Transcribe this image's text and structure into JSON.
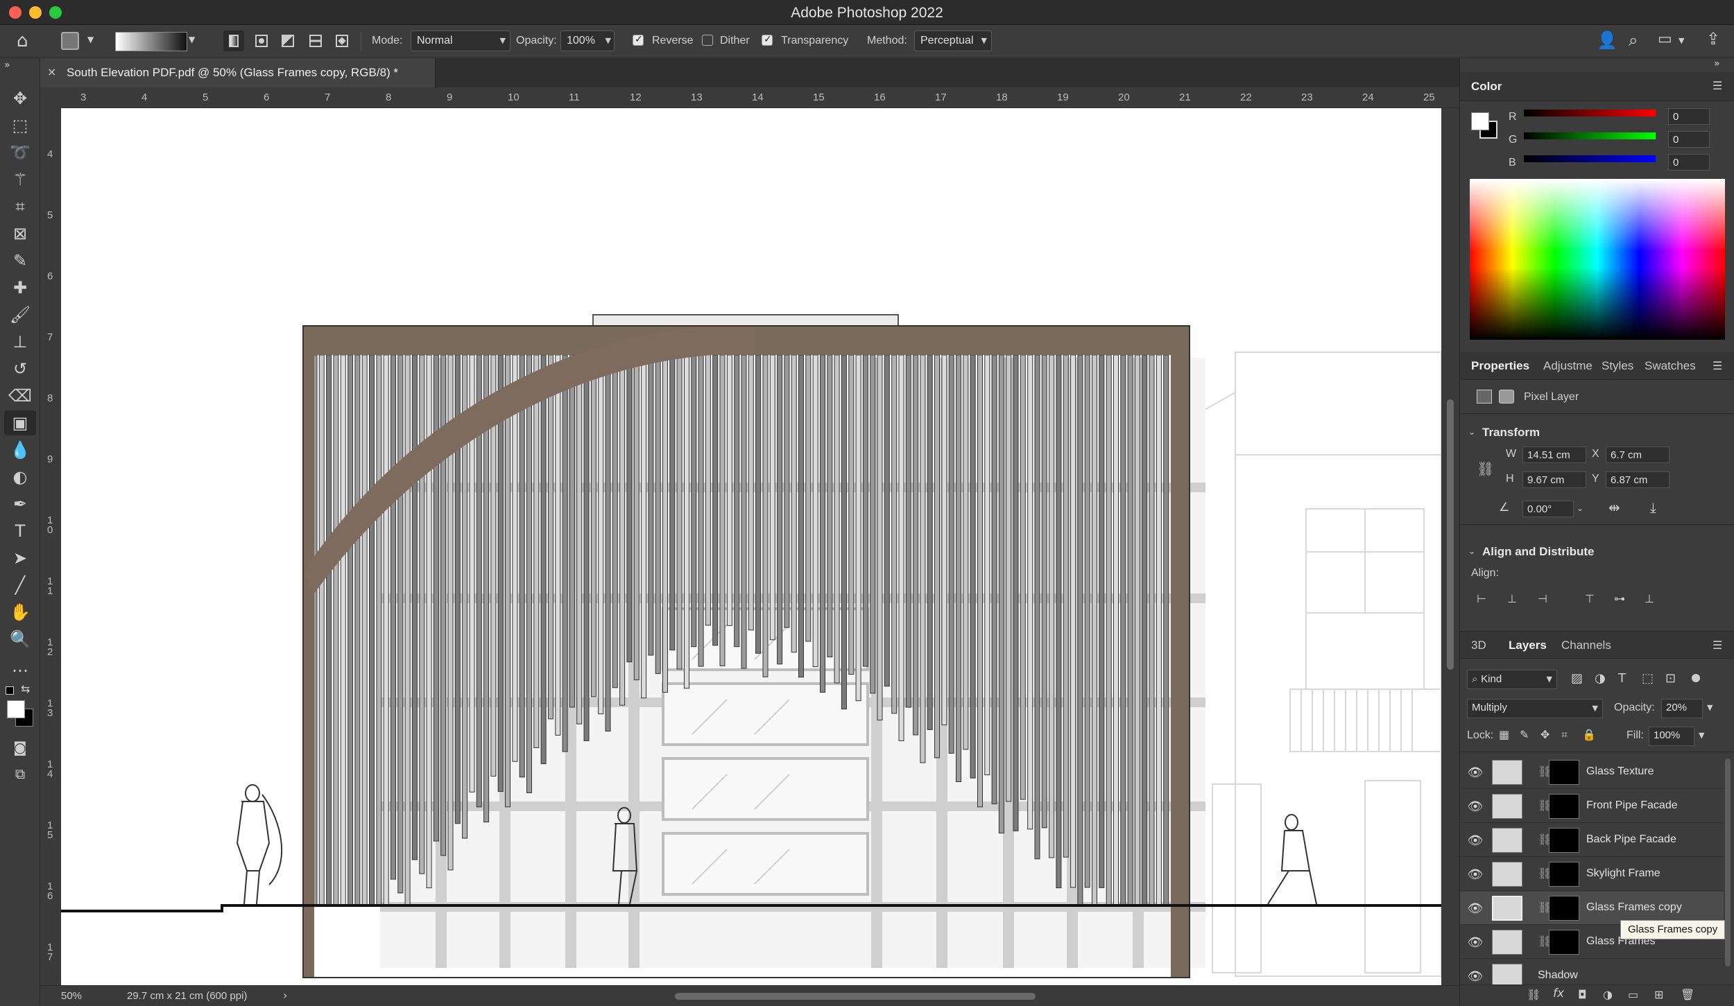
{
  "app": {
    "title": "Adobe Photoshop 2022"
  },
  "options": {
    "mode_label": "Mode:",
    "mode_value": "Normal",
    "opacity_label": "Opacity:",
    "opacity_value": "100%",
    "reverse_label": "Reverse",
    "reverse_checked": true,
    "dither_label": "Dither",
    "dither_checked": false,
    "transparency_label": "Transparency",
    "transparency_checked": true,
    "method_label": "Method:",
    "method_value": "Perceptual"
  },
  "document": {
    "tab_title": "South Elevation PDF.pdf @ 50% (Glass Frames copy, RGB/8) *",
    "ruler_top": [
      "3",
      "4",
      "5",
      "6",
      "7",
      "8",
      "9",
      "10",
      "11",
      "12",
      "13",
      "14",
      "15",
      "16",
      "17",
      "18",
      "19",
      "20",
      "21",
      "22",
      "23",
      "24",
      "25"
    ],
    "ruler_left": [
      "4",
      "5",
      "6",
      "7",
      "8",
      "9",
      "1\n0",
      "1\n1",
      "1\n2",
      "1\n3",
      "1\n4",
      "1\n5",
      "1\n6",
      "1\n7"
    ],
    "zoom": "50%",
    "doc_size": "29.7 cm x 21 cm (600 ppi)"
  },
  "color_panel": {
    "title": "Color",
    "r_label": "R",
    "r_value": "0",
    "g_label": "G",
    "g_value": "0",
    "b_label": "B",
    "b_value": "0"
  },
  "properties_panel": {
    "tabs": [
      "Properties",
      "Adjustme",
      "Styles",
      "Swatches"
    ],
    "layer_type": "Pixel Layer",
    "transform_heading": "Transform",
    "w_label": "W",
    "w_value": "14.51 cm",
    "x_label": "X",
    "x_value": "6.7 cm",
    "h_label": "H",
    "h_value": "9.67 cm",
    "y_label": "Y",
    "y_value": "6.87 cm",
    "angle_value": "0.00°",
    "align_heading": "Align and Distribute",
    "align_label": "Align:"
  },
  "layers_panel": {
    "tabs": [
      "3D",
      "Layers",
      "Channels"
    ],
    "filter_kind": "Kind",
    "blend_mode": "Multiply",
    "opacity_label": "Opacity:",
    "opacity_value": "20%",
    "lock_label": "Lock:",
    "fill_label": "Fill:",
    "fill_value": "100%",
    "layers": [
      {
        "name": "Glass Texture"
      },
      {
        "name": "Front Pipe Facade"
      },
      {
        "name": "Back Pipe Facade"
      },
      {
        "name": "Skylight Frame"
      },
      {
        "name": "Glass Frames copy"
      },
      {
        "name": "Glass Frames"
      },
      {
        "name": "Shadow"
      }
    ],
    "tooltip": "Glass Frames copy"
  }
}
